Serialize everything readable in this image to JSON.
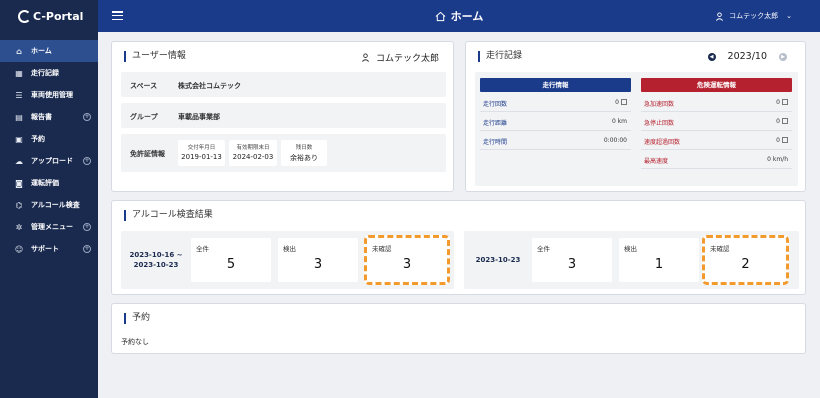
{
  "app": {
    "logo_text": "C-Portal"
  },
  "sidebar": {
    "items": [
      {
        "label": "ホーム",
        "icon": "home-icon",
        "active": true,
        "expandable": false
      },
      {
        "label": "走行記録",
        "icon": "table-icon",
        "active": false,
        "expandable": false
      },
      {
        "label": "車両使用管理",
        "icon": "list-icon",
        "active": false,
        "expandable": false
      },
      {
        "label": "報告書",
        "icon": "document-icon",
        "active": false,
        "expandable": true
      },
      {
        "label": "予約",
        "icon": "calendar-icon",
        "active": false,
        "expandable": false
      },
      {
        "label": "アップロード",
        "icon": "cloud-upload-icon",
        "active": false,
        "expandable": true
      },
      {
        "label": "運転評価",
        "icon": "car-icon",
        "active": false,
        "expandable": false
      },
      {
        "label": "アルコール検査",
        "icon": "alcohol-check-icon",
        "active": false,
        "expandable": false
      },
      {
        "label": "管理メニュー",
        "icon": "gear-icon",
        "active": false,
        "expandable": true
      },
      {
        "label": "サポート",
        "icon": "support-icon",
        "active": false,
        "expandable": true
      }
    ]
  },
  "header": {
    "title": "ホーム",
    "user_name": "コムテック太郎"
  },
  "user_info": {
    "title": "ユーザー情報",
    "user_name": "コムテック太郎",
    "space_label": "スペース",
    "space_value": "株式会社コムテック",
    "group_label": "グループ",
    "group_value": "車載品事業部",
    "license_label": "免許証情報",
    "license": [
      {
        "header": "交付年月日",
        "value": "2019-01-13"
      },
      {
        "header": "有効期限末日",
        "value": "2024-02-03"
      },
      {
        "header": "残日数",
        "value": "余裕あり"
      }
    ]
  },
  "driving_record": {
    "title": "走行記録",
    "month": "2023/10",
    "running_header": "走行情報",
    "danger_header": "危険運転情報",
    "running_rows": [
      {
        "label": "走行回数",
        "value": "0",
        "has_icon": true
      },
      {
        "label": "走行距離",
        "value": "0 km",
        "has_icon": false
      },
      {
        "label": "走行時間",
        "value": "0:00:00",
        "has_icon": false
      }
    ],
    "danger_rows": [
      {
        "label": "急加速回数",
        "value": "0",
        "has_icon": true
      },
      {
        "label": "急停止回数",
        "value": "0",
        "has_icon": true
      },
      {
        "label": "速度超過回数",
        "value": "0",
        "has_icon": true
      },
      {
        "label": "最高速度",
        "value": "0 km/h",
        "has_icon": false
      }
    ],
    "carousel_total": 5,
    "carousel_active": 5
  },
  "alcohol": {
    "title": "アルコール検査結果",
    "panels": [
      {
        "date_line1": "2023-10-16 ~",
        "date_line2": "2023-10-23",
        "stats": [
          {
            "label": "全件",
            "value": "5"
          },
          {
            "label": "検出",
            "value": "3"
          },
          {
            "label": "未確認",
            "value": "3"
          }
        ]
      },
      {
        "date_line1": "2023-10-23",
        "date_line2": "",
        "stats": [
          {
            "label": "全件",
            "value": "3"
          },
          {
            "label": "検出",
            "value": "1"
          },
          {
            "label": "未確認",
            "value": "2"
          }
        ]
      }
    ]
  },
  "reservation": {
    "title": "予約",
    "empty_text": "予約なし"
  },
  "colors": {
    "sidebar_bg": "#1a2a4f",
    "header_bg": "#1a3a8a",
    "running_header": "#1a3a8a",
    "danger_header": "#b5212e",
    "danger_text": "#b5212e",
    "running_text": "#1a3a8a",
    "highlight": "#f29a2e"
  }
}
